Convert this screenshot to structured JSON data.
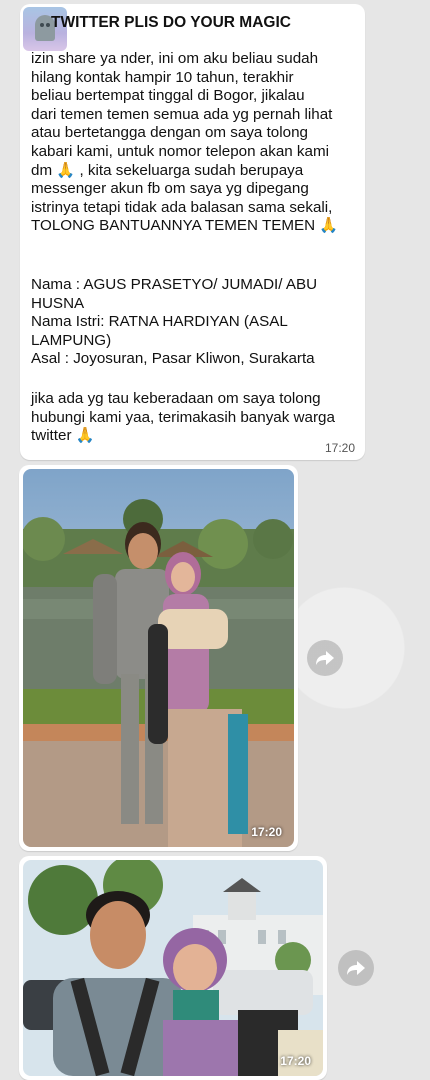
{
  "message": {
    "title": "TWITTER PLIS DO YOUR MAGIC",
    "paragraph1": [
      "izin share ya nder, ini om aku beliau sudah",
      "hilang kontak hampir 10 tahun, terakhir",
      "beliau bertempat tinggal di Bogor, jikalau",
      "dari temen temen semua ada yg pernah lihat",
      "atau bertetangga dengan om saya tolong",
      "kabari kami, untuk nomor telepon akan kami",
      "dm 🙏 , kita sekeluarga sudah berupaya",
      "messenger akun fb om saya yg dipegang",
      "istrinya tetapi tidak ada balasan sama sekali,",
      "TOLONG BANTUANNYA TEMEN TEMEN 🙏"
    ],
    "paragraph2": [
      "Nama : AGUS PRASETYO/ JUMADI/ ABU",
      "HUSNA",
      "Nama Istri: RATNA HARDIYAN (ASAL",
      "LAMPUNG)",
      "Asal : Joyosuran, Pasar Kliwon, Surakarta"
    ],
    "paragraph3": [
      "jika ada yg tau keberadaan om saya tolong",
      "hubungi kami yaa, terimakasih banyak warga",
      "twitter 🙏"
    ],
    "time": "17:20"
  },
  "photo1": {
    "time": "17:20"
  },
  "photo2": {
    "time": "17:20"
  }
}
